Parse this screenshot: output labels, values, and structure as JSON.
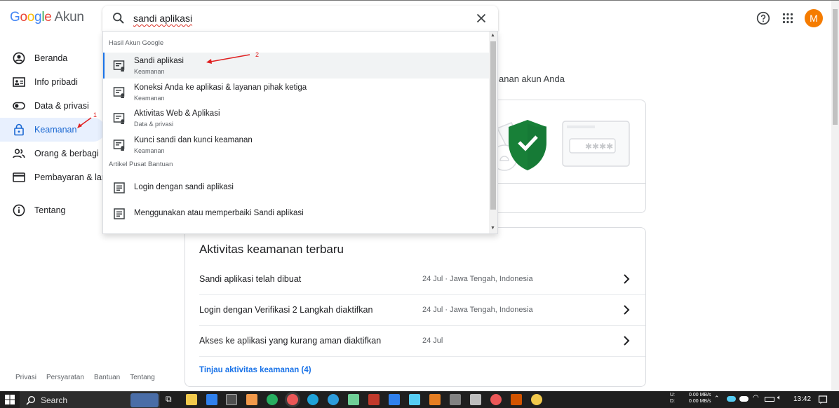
{
  "header": {
    "logo_letters": [
      "G",
      "o",
      "o",
      "g",
      "l",
      "e"
    ],
    "logo_suffix": "Akun",
    "help_icon": "help-circle-icon",
    "apps_icon": "apps-grid-icon",
    "avatar_letter": "M"
  },
  "search": {
    "value": "sandi aplikasi",
    "clear_icon": "close-icon"
  },
  "dropdown": {
    "section1_title": "Hasil Akun Google",
    "results": [
      {
        "title": "Sandi aplikasi",
        "subtitle": "Keamanan"
      },
      {
        "title": "Koneksi Anda ke aplikasi & layanan pihak ketiga",
        "subtitle": "Keamanan"
      },
      {
        "title": "Aktivitas Web & Aplikasi",
        "subtitle": "Data & privasi"
      },
      {
        "title": "Kunci sandi dan kunci keamanan",
        "subtitle": "Keamanan"
      }
    ],
    "section2_title": "Artikel Pusat Bantuan",
    "articles": [
      {
        "title": "Login dengan sandi aplikasi"
      },
      {
        "title": "Menggunakan atau memperbaiki Sandi aplikasi"
      }
    ]
  },
  "sidebar": {
    "items": [
      {
        "label": "Beranda",
        "icon": "account-circle-icon"
      },
      {
        "label": "Info pribadi",
        "icon": "id-card-icon"
      },
      {
        "label": "Data & privasi",
        "icon": "toggle-icon"
      },
      {
        "label": "Keamanan",
        "icon": "lock-icon",
        "active": true
      },
      {
        "label": "Orang & berbagi",
        "icon": "people-icon"
      },
      {
        "label": "Pembayaran & langganan",
        "icon": "credit-card-icon"
      },
      {
        "label": "Tentang",
        "icon": "info-icon"
      }
    ],
    "footer": [
      "Privasi",
      "Persyaratan",
      "Bantuan",
      "Tentang"
    ]
  },
  "main": {
    "intro_partial": "anan akun Anda",
    "activity": {
      "title": "Aktivitas keamanan terbaru",
      "rows": [
        {
          "label": "Sandi aplikasi telah dibuat",
          "meta": "24 Jul · Jawa Tengah, Indonesia"
        },
        {
          "label": "Login dengan Verifikasi 2 Langkah diaktifkan",
          "meta": "24 Jul · Jawa Tengah, Indonesia"
        },
        {
          "label": "Akses ke aplikasi yang kurang aman diaktifkan",
          "meta": "24 Jul"
        }
      ],
      "link": "Tinjau aktivitas keamanan (4)"
    }
  },
  "annotations": {
    "a1": "1",
    "a2": "2"
  },
  "taskbar": {
    "search_label": "Search",
    "net_up_label": "U:",
    "net_down_label": "D:",
    "net_up": "0.00 MB/s",
    "net_down": "0.00 MB/s",
    "time": "13:42"
  },
  "colors": {
    "accent": "#1a73e8",
    "avatar": "#f57c00",
    "shield": "#188038",
    "annotation": "#e02020"
  }
}
